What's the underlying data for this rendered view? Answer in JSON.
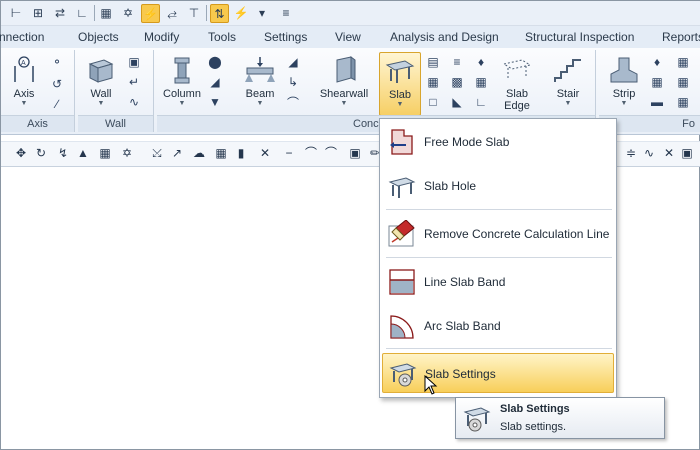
{
  "tabs": [
    "nnection",
    "Objects",
    "Modify",
    "Tools",
    "Settings",
    "View",
    "Analysis and Design",
    "Structural Inspection",
    "Reports"
  ],
  "ribbon": {
    "groups": {
      "axis": "Axis",
      "wall": "Wall",
      "concrete": "Conc",
      "far_right": "Fo"
    },
    "buttons": {
      "axis": "Axis",
      "wall": "Wall",
      "column": "Column",
      "beam": "Beam",
      "shearwall": "Shearwall",
      "slab": "Slab",
      "slab_edge_1": "Slab",
      "slab_edge_2": "Edge",
      "stair": "Stair",
      "strip": "Strip"
    }
  },
  "slab_menu": {
    "items": [
      {
        "label": "Free Mode Slab",
        "icon": "free-mode-slab-icon"
      },
      {
        "label": "Slab Hole",
        "icon": "slab-hole-icon"
      },
      {
        "label": "Remove Concrete Calculation Line",
        "icon": "eraser-icon"
      },
      {
        "label": "Line Slab Band",
        "icon": "line-slab-band-icon"
      },
      {
        "label": "Arc Slab Band",
        "icon": "arc-slab-band-icon"
      },
      {
        "label": "Slab Settings",
        "icon": "slab-settings-icon"
      }
    ]
  },
  "tooltip": {
    "title": "Slab Settings",
    "description": "Slab settings."
  },
  "colors": {
    "highlight": "#f8cf5a",
    "ribbon_bg": "#e9eff7",
    "menu_border": "#9aa6b4"
  }
}
